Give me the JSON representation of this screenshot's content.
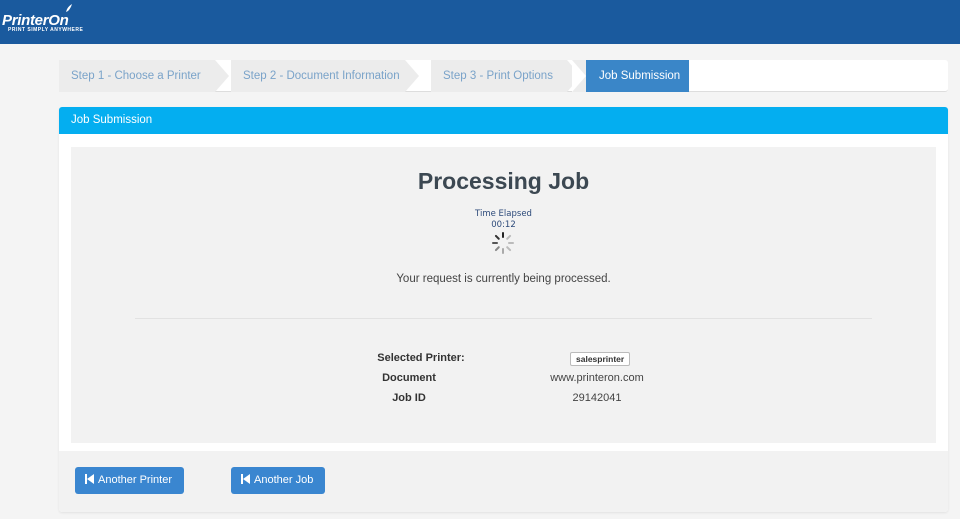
{
  "app": {
    "logo_text": "PrinterOn",
    "logo_tagline": "PRINT SIMPLY ANYWHERE"
  },
  "steps": [
    {
      "label": "Step 1 - Choose a Printer",
      "active": false
    },
    {
      "label": "Step 2 - Document Information",
      "active": false
    },
    {
      "label": "Step 3 - Print Options",
      "active": false
    },
    {
      "label": "Job Submission",
      "active": true
    }
  ],
  "panel": {
    "header": "Job Submission",
    "title": "Processing Job",
    "elapsed_label": "Time Elapsed",
    "elapsed_value": "00:12",
    "status_message": "Your request is currently being processed."
  },
  "details": {
    "printer_label": "Selected Printer:",
    "printer_value": "salesprinter",
    "document_label": "Document",
    "document_value": "www.printeron.com",
    "jobid_label": "Job ID",
    "jobid_value": "29142041"
  },
  "buttons": {
    "another_printer": "Another Printer",
    "another_job": "Another Job"
  },
  "colors": {
    "topbar": "#1a5a9e",
    "panel_header": "#04aef0",
    "active_step": "#3a86c8",
    "button": "#3a86d0"
  }
}
